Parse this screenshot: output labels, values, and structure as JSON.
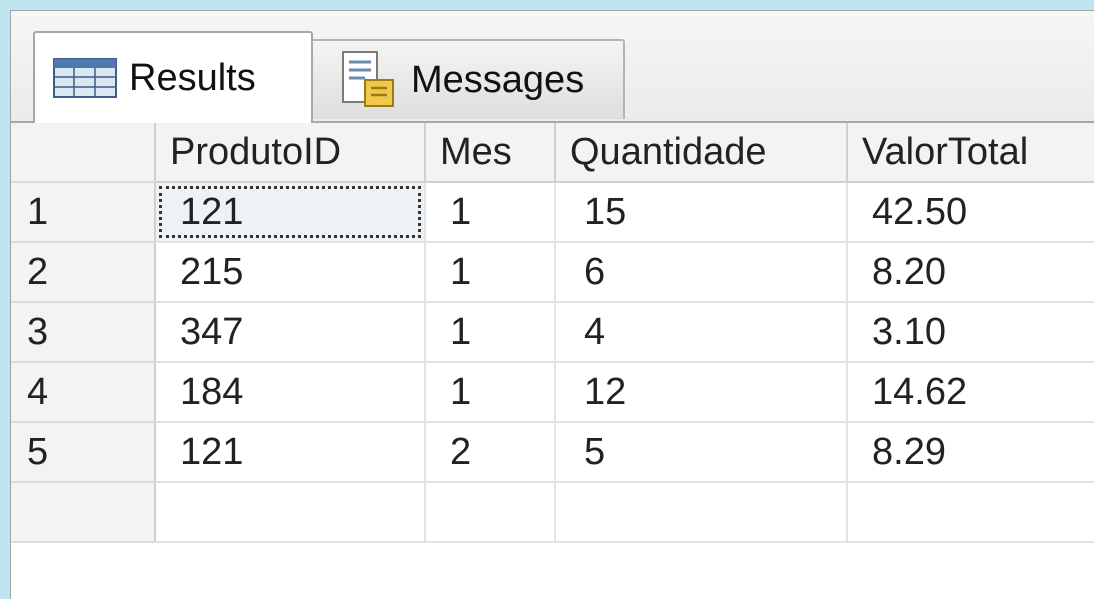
{
  "tabs": {
    "results": {
      "label": "Results",
      "icon": "grid-icon"
    },
    "messages": {
      "label": "Messages",
      "icon": "messages-icon"
    }
  },
  "grid": {
    "columns": [
      "ProdutoID",
      "Mes",
      "Quantidade",
      "ValorTotal"
    ],
    "rows": [
      {
        "num": "1",
        "cells": [
          "121",
          "1",
          "15",
          "42.50"
        ]
      },
      {
        "num": "2",
        "cells": [
          "215",
          "1",
          "6",
          "8.20"
        ]
      },
      {
        "num": "3",
        "cells": [
          "347",
          "1",
          "4",
          "3.10"
        ]
      },
      {
        "num": "4",
        "cells": [
          "184",
          "1",
          "12",
          "14.62"
        ]
      },
      {
        "num": "5",
        "cells": [
          "121",
          "2",
          "5",
          "8.29"
        ]
      }
    ],
    "selected_cell": "row 1, ProdutoID"
  },
  "colors": {
    "background": "#bfe6ef",
    "selected_cell": "#edf2f7"
  }
}
